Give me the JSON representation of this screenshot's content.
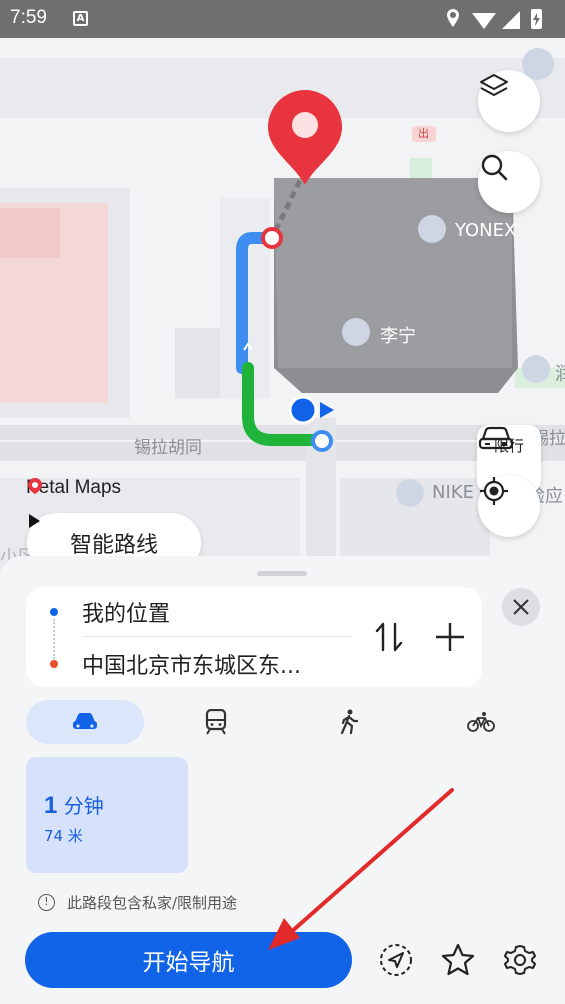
{
  "status_bar": {
    "time": "7:59",
    "notification_icon": "A",
    "icons": [
      "location-icon",
      "wifi-icon",
      "signal-icon",
      "battery-icon"
    ]
  },
  "map": {
    "labels": {
      "yonex": "YONEX",
      "lining": "李宁",
      "nike": "NIKE",
      "street1": "锡拉胡同",
      "street2": "锡拉",
      "experience": "验应",
      "district": "小区",
      "exit_sign": "出",
      "edge_char": "润"
    },
    "brand": "Petal Maps",
    "restrict_label": "限行",
    "smart_route_label": "智能路线"
  },
  "route": {
    "origin": "我的位置",
    "destination": "中国北京市东城区东..."
  },
  "modes": [
    {
      "name": "drive",
      "active": true
    },
    {
      "name": "transit",
      "active": false
    },
    {
      "name": "walk",
      "active": false
    },
    {
      "name": "bike",
      "active": false
    }
  ],
  "option": {
    "time_value": "1",
    "time_unit": "分钟",
    "distance": "74 米"
  },
  "warning": "此路段包含私家/限制用途",
  "start_label": "开始导航",
  "colors": {
    "accent": "#1163e8",
    "route_green": "#1fb33a",
    "route_blue": "#3d8ef0",
    "destination_red": "#e8343f",
    "annotation_red": "#e32a2a"
  }
}
